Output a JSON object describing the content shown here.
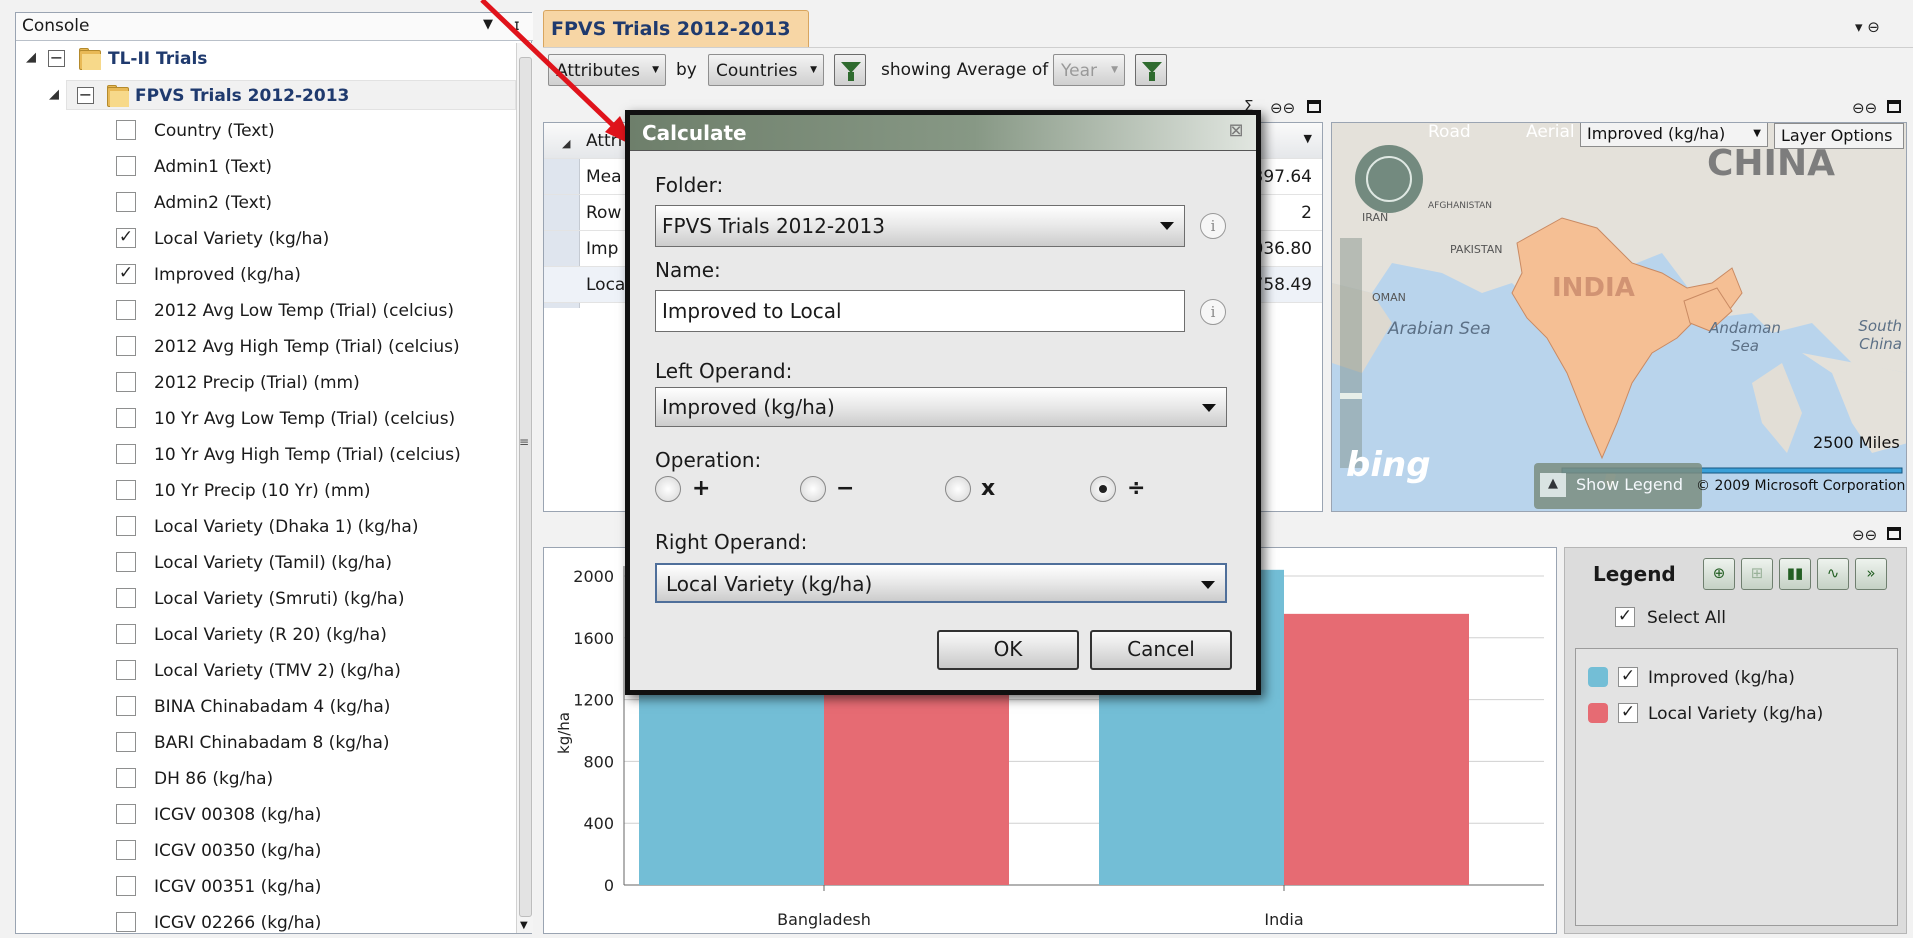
{
  "console": {
    "title": "Console"
  },
  "tree": {
    "root": {
      "label": "TL-II Trials"
    },
    "folder": {
      "label": "FPVS Trials 2012-2013"
    },
    "items": [
      {
        "label": "Country (Text)",
        "checked": false
      },
      {
        "label": "Admin1 (Text)",
        "checked": false
      },
      {
        "label": "Admin2 (Text)",
        "checked": false
      },
      {
        "label": "Local Variety (kg/ha)",
        "checked": true
      },
      {
        "label": "Improved (kg/ha)",
        "checked": true
      },
      {
        "label": "2012 Avg Low Temp (Trial) (celcius)",
        "checked": false
      },
      {
        "label": "2012 Avg High Temp (Trial) (celcius)",
        "checked": false
      },
      {
        "label": "2012 Precip (Trial) (mm)",
        "checked": false
      },
      {
        "label": "10 Yr Avg Low Temp (Trial) (celcius)",
        "checked": false
      },
      {
        "label": "10 Yr Avg High Temp (Trial) (celcius)",
        "checked": false
      },
      {
        "label": "10 Yr Precip (10 Yr) (mm)",
        "checked": false
      },
      {
        "label": "Local Variety (Dhaka 1) (kg/ha)",
        "checked": false
      },
      {
        "label": "Local Variety (Tamil) (kg/ha)",
        "checked": false
      },
      {
        "label": "Local Variety (Smruti) (kg/ha)",
        "checked": false
      },
      {
        "label": "Local Variety (R 20) (kg/ha)",
        "checked": false
      },
      {
        "label": "Local Variety (TMV 2) (kg/ha)",
        "checked": false
      },
      {
        "label": "BINA Chinabadam 4 (kg/ha)",
        "checked": false
      },
      {
        "label": "BARI Chinabadam 8 (kg/ha)",
        "checked": false
      },
      {
        "label": "DH 86 (kg/ha)",
        "checked": false
      },
      {
        "label": "ICGV 00308 (kg/ha)",
        "checked": false
      },
      {
        "label": "ICGV 00350 (kg/ha)",
        "checked": false
      },
      {
        "label": "ICGV 00351 (kg/ha)",
        "checked": false
      },
      {
        "label": "ICGV 02266 (kg/ha)",
        "checked": false
      }
    ]
  },
  "main_tab": {
    "label": "FPVS Trials 2012-2013"
  },
  "toolbar": {
    "attributes": "Attributes",
    "by": "by",
    "countries": "Countries",
    "showing": "showing Average of",
    "year": "Year"
  },
  "grid": {
    "header": "Attri",
    "rows": [
      {
        "label": "Mea",
        "value": "397.64"
      },
      {
        "label": "Row",
        "value": "2"
      },
      {
        "label": "Imp",
        "value": "036.80"
      },
      {
        "label": "Loca",
        "value": "758.49"
      }
    ]
  },
  "map": {
    "road": "Road",
    "aerial": "Aerial",
    "layer_select": "Improved (kg/ha)",
    "layer_options": "Layer Options",
    "labels": {
      "china": "CHINA",
      "india": "INDIA",
      "arabian_sea": "Arabian Sea",
      "andaman_sea": "Andaman Sea",
      "south_china": "South China",
      "oman": "OMAN",
      "pakistan": "PAKISTAN",
      "afghanistan": "AFGHANISTAN",
      "iran": "IRAN"
    },
    "scale": "2500 Miles",
    "bing": "bing",
    "show_legend": "Show Legend",
    "copyright": "© 2009 Microsoft Corporation"
  },
  "dialog": {
    "title": "Calculate",
    "folder_label": "Folder:",
    "folder_value": "FPVS Trials 2012-2013",
    "name_label": "Name:",
    "name_value": "Improved to Local",
    "left_label": "Left Operand:",
    "left_value": "Improved (kg/ha)",
    "operation_label": "Operation:",
    "ops": [
      "+",
      "−",
      "x",
      "÷"
    ],
    "selected_op": "÷",
    "right_label": "Right Operand:",
    "right_value": "Local Variety (kg/ha)",
    "ok": "OK",
    "cancel": "Cancel"
  },
  "chart_data": {
    "type": "bar",
    "categories": [
      "Bangladesh",
      "India"
    ],
    "series": [
      {
        "name": "Improved (kg/ha)",
        "color": "#73bed6",
        "values": [
          1900,
          2040
        ]
      },
      {
        "name": "Local Variety (kg/ha)",
        "color": "#e66b73",
        "values": [
          1800,
          1755
        ]
      }
    ],
    "ylabel": "kg/ha",
    "ylim": [
      0,
      2000
    ],
    "yticks": [
      "0",
      "400",
      "800",
      "1200",
      "1600",
      "2000"
    ]
  },
  "legend": {
    "title": "Legend",
    "select_all": "Select All",
    "items": [
      {
        "label": "Improved (kg/ha)",
        "color": "#73bed6"
      },
      {
        "label": "Local Variety (kg/ha)",
        "color": "#e66b73"
      }
    ]
  }
}
